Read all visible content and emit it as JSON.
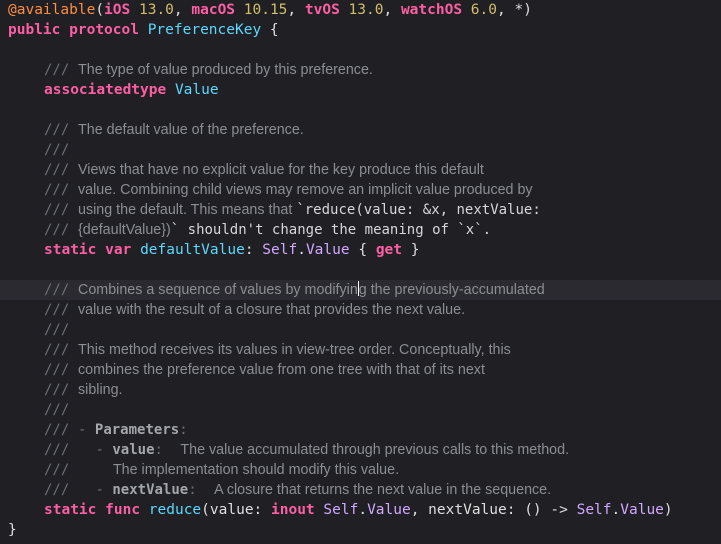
{
  "code": {
    "attr_line": {
      "attribute": "@available",
      "open": "(",
      "ios": "iOS",
      "ios_v": "13.0",
      "macos": "macOS",
      "macos_v": "10.15",
      "tvos": "tvOS",
      "tvos_v": "13.0",
      "watchos": "watchOS",
      "watchos_v": "6.0",
      "star": "*",
      "close": ")",
      "comma": ", "
    },
    "protocol_line": {
      "kw_public": "public",
      "kw_protocol": "protocol",
      "name": "PreferenceKey",
      "brace": " {"
    },
    "doc_slashes": "///",
    "doc_value_type": "The type of value produced by this preference.",
    "assoc_line": {
      "kw": "associatedtype",
      "name": "Value"
    },
    "doc_default_1": "The default value of the preference.",
    "doc_default_3": "Views that have no explicit value for the key produce this default",
    "doc_default_4": "value. Combining child views may remove an implicit value produced by",
    "doc_default_5a": "using the default. This means that ",
    "doc_default_5b": "`reduce(value: &x, nextValue:",
    "doc_default_6a": "{defaultValue})",
    "doc_default_6b": "` shouldn't change the meaning of `x`.",
    "default_line": {
      "kw_static": "static",
      "kw_var": "var",
      "name": "defaultValue",
      "colon": ": ",
      "self": "Self",
      "dot": ".",
      "value": "Value",
      "open": " { ",
      "get": "get",
      "close": " }"
    },
    "doc_reduce_1a": "Combines a sequence of values by modifyin",
    "doc_reduce_1b": "g the previously-accumulated",
    "doc_reduce_2": "value with the result of a closure that provides the next value.",
    "doc_reduce_4": "This method receives its values in view-tree order. Conceptually, this",
    "doc_reduce_5": "combines the preference value from one tree with that of its next",
    "doc_reduce_6": "sibling.",
    "doc_params": {
      "dash": "- ",
      "label": "Parameters",
      "colon": ":",
      "p1_name": "value",
      "p1_desc": "The value accumulated through previous calls to this method.",
      "p1_desc2": "The implementation should modify this value.",
      "p2_name": "nextValue",
      "p2_desc": "A closure that returns the next value in the sequence."
    },
    "reduce_line": {
      "kw_static": "static",
      "kw_func": "func",
      "name": "reduce",
      "p1": "(value: ",
      "inout": "inout",
      "self": "Self",
      "dot": ".",
      "value": "Value",
      "p2": ", nextValue: () -> ",
      "close": ")"
    },
    "closing_brace": "}"
  },
  "colors": {
    "background": "#1f1f24",
    "keyword": "#fc5fa3",
    "type_decl": "#5dd8ff",
    "type_ref": "#d0a8ff",
    "number": "#d0bf69",
    "attribute": "#fd8f3f",
    "comment": "#8b8e93"
  }
}
